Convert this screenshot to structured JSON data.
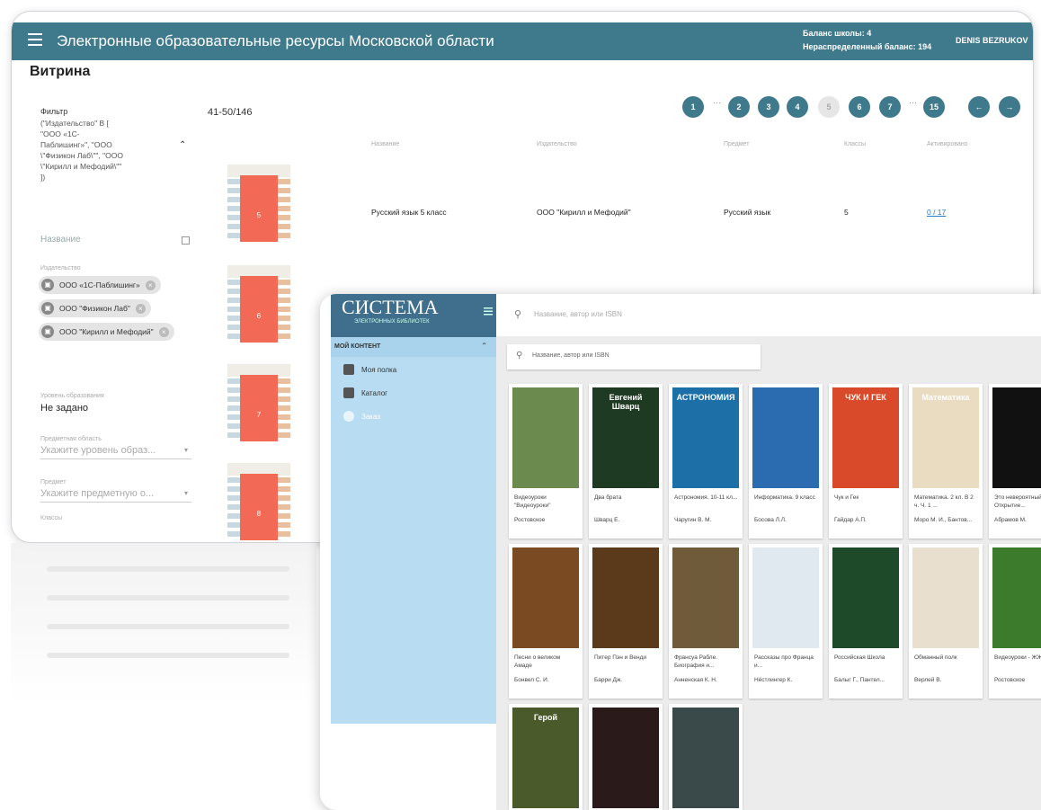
{
  "app": {
    "title": "Электронные образовательные ресурсы Московской области",
    "balance_school": "Баланс школы: 4",
    "balance_unallocated": "Нераспределенный баланс: 194",
    "user": "DENIS BEZRUKOV"
  },
  "page_title": "Витрина",
  "filter": {
    "label": "Фильтр",
    "text": "(\"Издательство\" В [\n\"ООО «1С-\nПаблишинг»\", \"ООО\n\\\"Физикон Лаб\\\"\", \"ООО\n\\\"Кирилл и Мефодий\\\"\"\n])",
    "name_placeholder": "Название",
    "publisher_label": "Издательство",
    "chips": [
      "ООО «1С-Паблишинг»",
      "ООО \"Физикон Лаб\"",
      "ООО \"Кирилл и Мефодий\""
    ],
    "level_label": "Уровень образования",
    "level_value": "Не задано",
    "area_label": "Предметная область",
    "area_placeholder": "Укажите уровень образ...",
    "subject_label": "Предмет",
    "subject_placeholder": "Укажите предметную о...",
    "classes_label": "Классы"
  },
  "results": {
    "range": "41-50/146",
    "pages": [
      "1",
      "2",
      "3",
      "4",
      "5",
      "6",
      "7",
      "15"
    ],
    "active_page": "5",
    "columns": [
      "Название",
      "Издательство",
      "Предмет",
      "Классы",
      "Активировано"
    ],
    "row": {
      "name": "Русский язык 5 класс",
      "publisher": "ООО \"Кирилл и Мефодий\"",
      "subject": "Русский язык",
      "classes": "5",
      "activated": "0 / 17"
    },
    "thumb_numbers": [
      "5",
      "6",
      "7",
      "8"
    ]
  },
  "library": {
    "logo": "СИСТЕМА",
    "logo_sub": "ЭЛЕКТРОННЫХ БИБЛИОТЕК",
    "section": "МОЙ КОНТЕНТ",
    "nav": [
      "Моя полка",
      "Каталог",
      "Заказ"
    ],
    "search_placeholder": "Название, автор или ISBN",
    "search2_placeholder": "Название, автор или ISBN",
    "books": [
      {
        "title": "Видеоуроки \"Видеоуроки\"",
        "author": "Ростовское",
        "cover": "#6b8a4e",
        "cover_text": ""
      },
      {
        "title": "Два брата",
        "author": "Шварц Е.",
        "cover": "#1f3a22",
        "cover_text": "Евгений Шварц"
      },
      {
        "title": "Астрономия. 10-11 кл...",
        "author": "Чаругин В. М.",
        "cover": "#1d6fa8",
        "cover_text": "АСТРОНОМИЯ"
      },
      {
        "title": "Информатика. 9 класс",
        "author": "Босова Л.Л.",
        "cover": "#2b6cb0",
        "cover_text": ""
      },
      {
        "title": "Чук и Гек",
        "author": "Гайдар А.П.",
        "cover": "#d84a2a",
        "cover_text": "ЧУК И ГЕК"
      },
      {
        "title": "Математика. 2 кл. В 2 ч. Ч. 1 ...",
        "author": "Моро М. И., Бантов...",
        "cover": "#e9dcc0",
        "cover_text": "Математика"
      },
      {
        "title": "Это невероятный Открытие...",
        "author": "Абрамов М.",
        "cover": "#111111",
        "cover_text": ""
      },
      {
        "title": "Песни о великом Амаде",
        "author": "Бонвел С. И.",
        "cover": "#7a4a22",
        "cover_text": ""
      },
      {
        "title": "Питер Пэн и Венди",
        "author": "Барри Дж.",
        "cover": "#5a3a1a",
        "cover_text": ""
      },
      {
        "title": "Франсуа Рабле. Биография и...",
        "author": "Анненская К. Н.",
        "cover": "#6f5a3a",
        "cover_text": ""
      },
      {
        "title": "Рассказы про Франца и...",
        "author": "Нёстлингер К.",
        "cover": "#dfe9ef",
        "cover_text": ""
      },
      {
        "title": "Российская Школа",
        "author": "Балыг Г., Пантел...",
        "cover": "#1e4a2a",
        "cover_text": ""
      },
      {
        "title": "Обманный полк",
        "author": "Верлей В.",
        "cover": "#e8dfcf",
        "cover_text": ""
      },
      {
        "title": "Видеоуроки - ЖЖ",
        "author": "Ростовское",
        "cover": "#3c7a2c",
        "cover_text": ""
      },
      {
        "title": "",
        "author": "",
        "cover": "#4a5a2a",
        "cover_text": "Герой"
      },
      {
        "title": "",
        "author": "",
        "cover": "#2a1a1a",
        "cover_text": ""
      },
      {
        "title": "",
        "author": "",
        "cover": "#3a4a4a",
        "cover_text": ""
      }
    ]
  }
}
